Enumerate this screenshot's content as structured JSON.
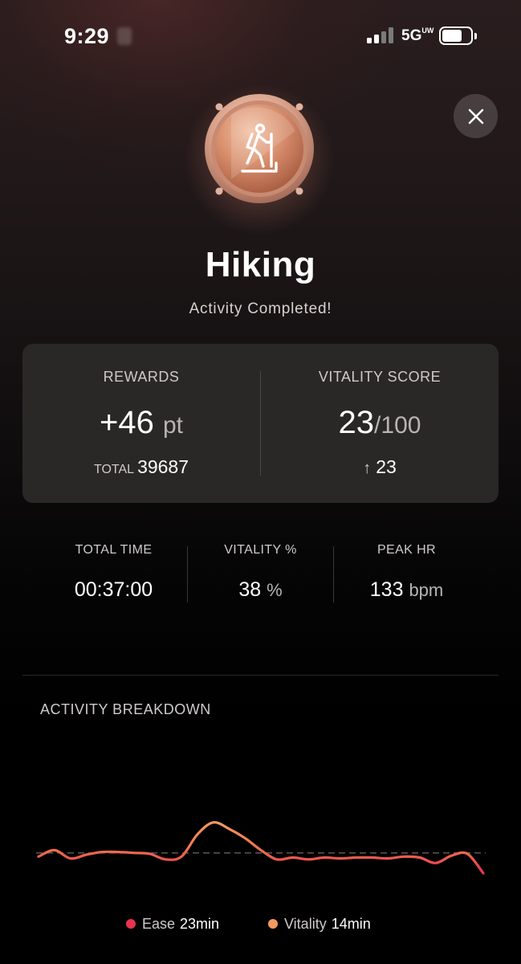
{
  "status_bar": {
    "time": "9:29",
    "network": "5G",
    "network_suffix": "UW"
  },
  "activity": {
    "name": "Hiking",
    "status": "Activity Completed!",
    "badge_icon": "hiker-icon"
  },
  "rewards": {
    "label": "REWARDS",
    "value": "+46",
    "unit": "pt",
    "total_label": "TOTAL",
    "total_value": "39687"
  },
  "vitality_score": {
    "label": "VITALITY SCORE",
    "value": "23",
    "max": "/100",
    "change": "23"
  },
  "stats": [
    {
      "label": "TOTAL TIME",
      "value": "00:37:00",
      "unit": ""
    },
    {
      "label": "VITALITY %",
      "value": "38",
      "unit": "%"
    },
    {
      "label": "PEAK HR",
      "value": "133",
      "unit": "bpm"
    }
  ],
  "breakdown": {
    "title": "ACTIVITY BREAKDOWN",
    "legend": [
      {
        "label": "Ease",
        "value": "23min",
        "color": "#e8334f"
      },
      {
        "label": "Vitality",
        "value": "14min",
        "color": "#f59a5e"
      }
    ]
  },
  "chart_data": {
    "type": "line",
    "x": [
      0,
      1,
      2,
      3,
      4,
      5,
      6,
      7,
      8,
      9,
      10,
      11,
      12,
      13,
      14,
      15,
      16,
      17,
      18,
      19,
      20,
      21,
      22,
      23,
      24,
      25,
      26,
      27,
      28,
      29,
      30,
      31,
      32,
      33,
      34,
      35,
      36,
      37
    ],
    "y": [
      0.38,
      0.45,
      0.36,
      0.4,
      0.43,
      0.43,
      0.42,
      0.41,
      0.35,
      0.38,
      0.62,
      0.75,
      0.68,
      0.58,
      0.45,
      0.35,
      0.37,
      0.35,
      0.37,
      0.36,
      0.37,
      0.37,
      0.36,
      0.38,
      0.37,
      0.31,
      0.39,
      0.41,
      0.2
    ],
    "threshold": 0.42,
    "colors": {
      "ease": "#e8334f",
      "vitality": "#f59a5e",
      "threshold": "#5a5656"
    }
  }
}
